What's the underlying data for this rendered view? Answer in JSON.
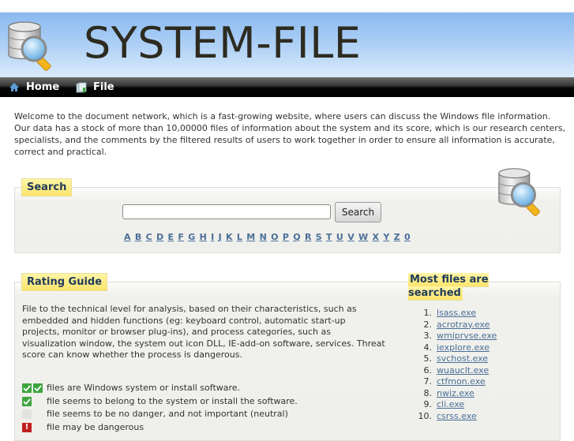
{
  "header": {
    "title": "SYSTEM-FILE",
    "logo_icon": "database-search-icon"
  },
  "nav": {
    "items": [
      {
        "label": "Home",
        "icon": "home-icon"
      },
      {
        "label": "File",
        "icon": "file-icon"
      }
    ]
  },
  "intro": {
    "text": "Welcome to the document network, which is a fast-growing website, where users can discuss the Windows file information. Our data has a stock of more than 10,00000 files of information about the system and its score, which is our research centers, specialists, and the comments by the filtered results of users to work together in order to ensure all information is accurate, correct and practical."
  },
  "search": {
    "heading": "Search",
    "input_value": "",
    "input_placeholder": "",
    "button_label": "Search",
    "icon": "database-search-icon",
    "letters": [
      "A",
      "B",
      "C",
      "D",
      "E",
      "F",
      "G",
      "H",
      "I",
      "J",
      "K",
      "L",
      "M",
      "N",
      "O",
      "P",
      "Q",
      "R",
      "S",
      "T",
      "U",
      "V",
      "W",
      "X",
      "Y",
      "Z",
      "0"
    ]
  },
  "rating": {
    "heading": "Rating Guide",
    "description": "File to the technical level for analysis, based on their characteristics, such as embedded and hidden functions (eg: keyboard control, automatic start-up projects, monitor or browser plug-ins), and process categories, such as visualization window, the system out icon DLL, IE-add-on software, services. Threat score can know whether the process is dangerous.",
    "legend": [
      {
        "icon": "double-check-icon",
        "text": "files are Windows system or install software."
      },
      {
        "icon": "check-icon",
        "text": "file seems to belong to the system or install the software."
      },
      {
        "icon": "neutral-icon",
        "text": "file seems to be no danger, and not important (neutral)"
      },
      {
        "icon": "danger-icon",
        "text": "file may be dangerous"
      }
    ],
    "colors": {
      "safe": "#3ea53e",
      "neutral": "#e2e2e0",
      "danger": "#c02020"
    }
  },
  "most_searched": {
    "heading": "Most files are searched",
    "items": [
      {
        "num": "1.",
        "name": "lsass.exe"
      },
      {
        "num": "2.",
        "name": "acrotray.exe"
      },
      {
        "num": "3.",
        "name": "wmiprvse.exe"
      },
      {
        "num": "4.",
        "name": "iexplore.exe"
      },
      {
        "num": "5.",
        "name": "svchost.exe"
      },
      {
        "num": "6.",
        "name": "wuauclt.exe"
      },
      {
        "num": "7.",
        "name": "ctfmon.exe"
      },
      {
        "num": "8.",
        "name": "nwiz.exe"
      },
      {
        "num": "9.",
        "name": "cli.exe"
      },
      {
        "num": "10.",
        "name": "csrss.exe"
      }
    ]
  }
}
